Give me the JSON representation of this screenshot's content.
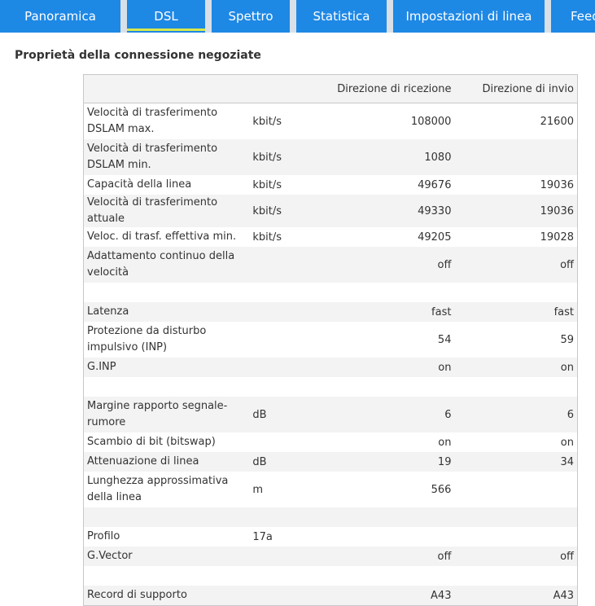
{
  "tabs": [
    {
      "label": "Panoramica",
      "active": false
    },
    {
      "label": "DSL",
      "active": true
    },
    {
      "label": "Spettro",
      "active": false
    },
    {
      "label": "Statistica",
      "active": false
    },
    {
      "label": "Impostazioni di linea",
      "active": false
    },
    {
      "label": "Feed",
      "active": false
    }
  ],
  "section_title": "Proprietà della connessione negoziate",
  "table": {
    "columns": [
      "",
      "",
      "Direzione di ricezione",
      "Direzione di invio"
    ],
    "rows": [
      {
        "label": "Velocità di trasferimento DSLAM max.",
        "unit": "kbit/s",
        "rx": "108000",
        "tx": "21600"
      },
      {
        "label": "Velocità di trasferimento DSLAM min.",
        "unit": "kbit/s",
        "rx": "1080",
        "tx": ""
      },
      {
        "label": "Capacità della linea",
        "unit": "kbit/s",
        "rx": "49676",
        "tx": "19036"
      },
      {
        "label": "Velocità di trasferimento attuale",
        "unit": "kbit/s",
        "rx": "49330",
        "tx": "19036"
      },
      {
        "label": "Veloc. di trasf. effettiva min.",
        "unit": "kbit/s",
        "rx": "49205",
        "tx": "19028"
      },
      {
        "label": "Adattamento continuo della velocità",
        "unit": "",
        "rx": "off",
        "tx": "off"
      },
      {
        "label": "",
        "unit": "",
        "rx": "",
        "tx": ""
      },
      {
        "label": "Latenza",
        "unit": "",
        "rx": "fast",
        "tx": "fast"
      },
      {
        "label": "Protezione da disturbo impulsivo (INP)",
        "unit": "",
        "rx": "54",
        "tx": "59"
      },
      {
        "label": "G.INP",
        "unit": "",
        "rx": "on",
        "tx": "on"
      },
      {
        "label": "",
        "unit": "",
        "rx": "",
        "tx": ""
      },
      {
        "label": "Margine rapporto segnale-rumore",
        "unit": "dB",
        "rx": "6",
        "tx": "6"
      },
      {
        "label": "Scambio di bit (bitswap)",
        "unit": "",
        "rx": "on",
        "tx": "on"
      },
      {
        "label": "Attenuazione di linea",
        "unit": "dB",
        "rx": "19",
        "tx": "34"
      },
      {
        "label": "Lunghezza approssimativa della linea",
        "unit": "m",
        "rx": "566",
        "tx": ""
      },
      {
        "label": "",
        "unit": "",
        "rx": "",
        "tx": ""
      },
      {
        "label": "Profilo",
        "unit": "17a",
        "rx": "",
        "tx": ""
      },
      {
        "label": "G.Vector",
        "unit": "",
        "rx": "off",
        "tx": "off"
      },
      {
        "label": "",
        "unit": "",
        "rx": "",
        "tx": ""
      },
      {
        "label": "Record di supporto",
        "unit": "",
        "rx": "A43",
        "tx": "A43"
      }
    ]
  }
}
